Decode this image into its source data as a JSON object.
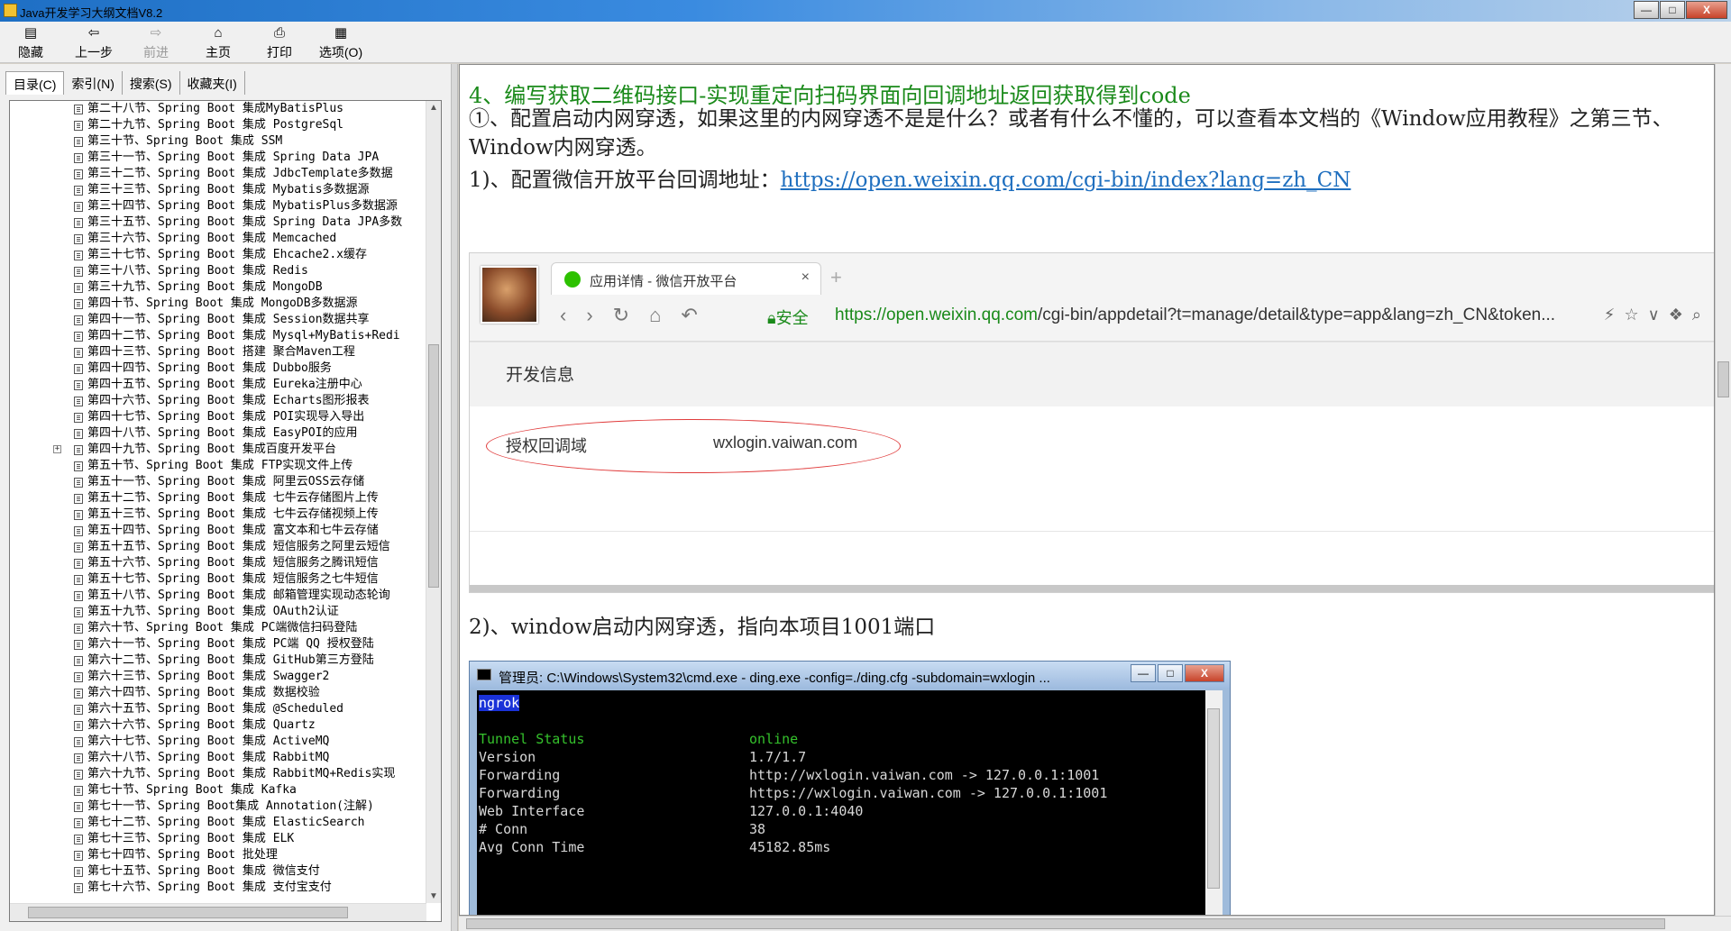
{
  "window": {
    "title": "Java开发学习大纲文档V8.2",
    "controls": {
      "minimize": "—",
      "maximize": "□",
      "close": "X"
    }
  },
  "toolbar": {
    "buttons": [
      {
        "label": "隐藏",
        "icon": "hide-icon",
        "enabled": true
      },
      {
        "label": "上一步",
        "icon": "back-icon",
        "enabled": true
      },
      {
        "label": "前进",
        "icon": "forward-icon",
        "enabled": false
      },
      {
        "label": "主页",
        "icon": "home-icon",
        "enabled": true
      },
      {
        "label": "打印",
        "icon": "print-icon",
        "enabled": true
      },
      {
        "label": "选项(O)",
        "icon": "options-icon",
        "enabled": true
      }
    ]
  },
  "sidebar": {
    "tabs": [
      "目录(C)",
      "索引(N)",
      "搜索(S)",
      "收藏夹(I)"
    ],
    "active_tab": 0,
    "items": [
      "第二十八节、Spring Boot 集成MyBatisPlus",
      "第二十九节、Spring Boot 集成 PostgreSql",
      "第三十节、Spring Boot 集成 SSM",
      "第三十一节、Spring Boot 集成 Spring Data JPA",
      "第三十二节、Spring Boot 集成 JdbcTemplate多数据",
      "第三十三节、Spring Boot 集成 Mybatis多数据源",
      "第三十四节、Spring Boot 集成 MybatisPlus多数据源",
      "第三十五节、Spring Boot 集成 Spring Data JPA多数",
      "第三十六节、Spring Boot 集成 Memcached",
      "第三十七节、Spring Boot 集成 Ehcache2.x缓存",
      "第三十八节、Spring Boot 集成 Redis",
      "第三十九节、Spring Boot 集成 MongoDB",
      "第四十节、Spring Boot 集成 MongoDB多数据源",
      "第四十一节、Spring Boot 集成 Session数据共享",
      "第四十二节、Spring Boot 集成 Mysql+MyBatis+Redi",
      "第四十三节、Spring Boot 搭建 聚合Maven工程",
      "第四十四节、Spring Boot 集成 Dubbo服务",
      "第四十五节、Spring Boot 集成 Eureka注册中心",
      "第四十六节、Spring Boot 集成 Echarts图形报表",
      "第四十七节、Spring Boot 集成 POI实现导入导出",
      "第四十八节、Spring Boot 集成 EasyPOI的应用",
      "第四十九节、Spring Boot 集成百度开发平台",
      "第五十节、Spring Boot 集成 FTP实现文件上传",
      "第五十一节、Spring Boot 集成 阿里云OSS云存储",
      "第五十二节、Spring Boot 集成 七牛云存储图片上传",
      "第五十三节、Spring Boot 集成 七牛云存储视频上传",
      "第五十四节、Spring Boot 集成 富文本和七牛云存储",
      "第五十五节、Spring Boot 集成 短信服务之阿里云短信",
      "第五十六节、Spring Boot 集成 短信服务之腾讯短信",
      "第五十七节、Spring Boot 集成 短信服务之七牛短信",
      "第五十八节、Spring Boot 集成 邮箱管理实现动态轮询",
      "第五十九节、Spring Boot 集成 OAuth2认证",
      "第六十节、Spring Boot 集成 PC端微信扫码登陆",
      "第六十一节、Spring Boot 集成 PC端 QQ 授权登陆",
      "第六十二节、Spring Boot 集成 GitHub第三方登陆",
      "第六十三节、Spring Boot 集成 Swagger2",
      "第六十四节、Spring Boot 集成 数据校验",
      "第六十五节、Spring Boot 集成 @Scheduled",
      "第六十六节、Spring Boot 集成 Quartz",
      "第六十七节、Spring Boot 集成 ActiveMQ",
      "第六十八节、Spring Boot 集成 RabbitMQ",
      "第六十九节、Spring Boot 集成 RabbitMQ+Redis实现",
      "第七十节、Spring Boot 集成 Kafka",
      "第七十一节、Spring Boot集成 Annotation(注解)",
      "第七十二节、Spring Boot 集成 ElasticSearch",
      "第七十三节、Spring Boot 集成 ELK",
      "第七十四节、Spring Boot 批处理",
      "第七十五节、Spring Boot 集成 微信支付",
      "第七十六节、Spring Boot 集成 支付宝支付"
    ]
  },
  "content": {
    "heading": "4、编写获取二维码接口-实现重定向扫码界面向回调地址返回获取得到code",
    "para1": "①、配置启动内网穿透，如果这里的内网穿透不是是什么？或者有什么不懂的，可以查看本文档的《Window应用教程》之第三节、Window内网穿透。",
    "step1_prefix": "1)、配置微信开放平台回调地址：",
    "step1_link": "https://open.weixin.qq.com/cgi-bin/index?lang=zh_CN",
    "step2": "2)、window启动内网穿透，指向本项目1001端口"
  },
  "browser_shot": {
    "tab_title": "应用详情 - 微信开放平台",
    "tab_close": "×",
    "new_tab": "+",
    "secure_label": "安全",
    "url_prefix": "https://open.weixin.qq.com",
    "url_rest": "/cgi-bin/appdetail?t=manage/detail&type=app&lang=zh_CN&token...",
    "section_title": "开发信息",
    "callback_label": "授权回调域",
    "callback_value": "wxlogin.vaiwan.com"
  },
  "cmd_shot": {
    "title": "管理员: C:\\Windows\\System32\\cmd.exe - ding.exe  -config=./ding.cfg -subdomain=wxlogin ...",
    "banner": "ngrok",
    "rows": [
      {
        "k": "Tunnel Status",
        "v": "online",
        "green": true
      },
      {
        "k": "Version",
        "v": "1.7/1.7",
        "green": false
      },
      {
        "k": "Forwarding",
        "v": "http://wxlogin.vaiwan.com -> 127.0.0.1:1001",
        "green": false
      },
      {
        "k": "Forwarding",
        "v": "https://wxlogin.vaiwan.com -> 127.0.0.1:1001",
        "green": false
      },
      {
        "k": "Web Interface",
        "v": "127.0.0.1:4040",
        "green": false
      },
      {
        "k": "# Conn",
        "v": "38",
        "green": false
      },
      {
        "k": "Avg Conn Time",
        "v": "45182.85ms",
        "green": false
      }
    ]
  },
  "colors": {
    "heading": "#1a8a1a",
    "link": "#1f6fbf",
    "callout": "#e03b3b"
  }
}
